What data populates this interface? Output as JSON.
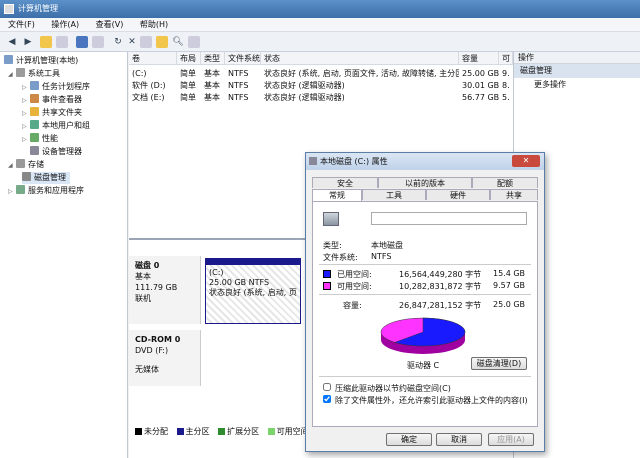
{
  "window": {
    "title": "计算机管理"
  },
  "menu": [
    "文件(F)",
    "操作(A)",
    "查看(V)",
    "帮助(H)"
  ],
  "tree": [
    {
      "label": "计算机管理(本地)",
      "icon": "computer-icon"
    },
    {
      "label": "系统工具",
      "icon": "tools-icon"
    },
    {
      "label": "任务计划程序",
      "icon": "clock-icon"
    },
    {
      "label": "事件查看器",
      "icon": "event-icon"
    },
    {
      "label": "共享文件夹",
      "icon": "folder-icon"
    },
    {
      "label": "本地用户和组",
      "icon": "users-icon"
    },
    {
      "label": "性能",
      "icon": "performance-icon"
    },
    {
      "label": "设备管理器",
      "icon": "device-icon"
    },
    {
      "label": "存储",
      "icon": "storage-icon"
    },
    {
      "label": "磁盘管理",
      "icon": "disk-icon"
    },
    {
      "label": "服务和应用程序",
      "icon": "services-icon"
    }
  ],
  "volumes": {
    "headers": [
      "卷",
      "布局",
      "类型",
      "文件系统",
      "状态",
      "容量",
      "可"
    ],
    "rows": [
      {
        "vol": "(C:)",
        "layout": "简单",
        "type": "基本",
        "fs": "NTFS",
        "status": "状态良好 (系统, 启动, 页面文件, 活动, 故障转储, 主分区)",
        "cap": "25.00 GB",
        "free": "9."
      },
      {
        "vol": "软件 (D:)",
        "layout": "简单",
        "type": "基本",
        "fs": "NTFS",
        "status": "状态良好 (逻辑驱动器)",
        "cap": "30.01 GB",
        "free": "8."
      },
      {
        "vol": "文档 (E:)",
        "layout": "简单",
        "type": "基本",
        "fs": "NTFS",
        "status": "状态良好 (逻辑驱动器)",
        "cap": "56.77 GB",
        "free": "5."
      }
    ]
  },
  "disks": [
    {
      "name": "磁盘 0",
      "type": "基本",
      "size": "111.79 GB",
      "state": "联机",
      "part": {
        "name": "(C:)",
        "info": "25.00 GB NTFS",
        "status": "状态良好 (系统, 启动, 页面"
      }
    },
    {
      "name": "CD-ROM 0",
      "type": "DVD (F:)",
      "size": "",
      "state": "无媒体"
    }
  ],
  "legend": [
    "未分配",
    "主分区",
    "扩展分区",
    "可用空间",
    "逻"
  ],
  "colors": {
    "unalloc": "#000000",
    "primary": "#1a1a8c",
    "extended": "#2e8b2e",
    "free": "#7bd36b",
    "used": "#1a1aff",
    "freespace": "#ff33ff"
  },
  "actions": {
    "title": "操作",
    "section": "磁盘管理",
    "more": "更多操作"
  },
  "dialog": {
    "title": "本地磁盘 (C:) 属性",
    "tabs_row1": [
      "安全",
      "以前的版本",
      "配额"
    ],
    "tabs_row2": [
      "常规",
      "工具",
      "硬件",
      "共享"
    ],
    "type_label": "类型:",
    "type_value": "本地磁盘",
    "fs_label": "文件系统:",
    "fs_value": "NTFS",
    "used_label": "已用空间:",
    "used_bytes": "16,564,449,280 字节",
    "used_gb": "15.4 GB",
    "free_label": "可用空间:",
    "free_bytes": "10,282,831,872 字节",
    "free_gb": "9.57 GB",
    "cap_label": "容量:",
    "cap_bytes": "26,847,281,152 字节",
    "cap_gb": "25.0 GB",
    "drive_label": "驱动器 C",
    "cleanup": "磁盘清理(D)",
    "compress": "压缩此驱动器以节约磁盘空间(C)",
    "index": "除了文件属性外，还允许索引此驱动器上文件的内容(I)",
    "compress_checked": false,
    "index_checked": true,
    "used_fraction": 0.617,
    "ok": "确定",
    "cancel": "取消",
    "apply": "应用(A)"
  }
}
